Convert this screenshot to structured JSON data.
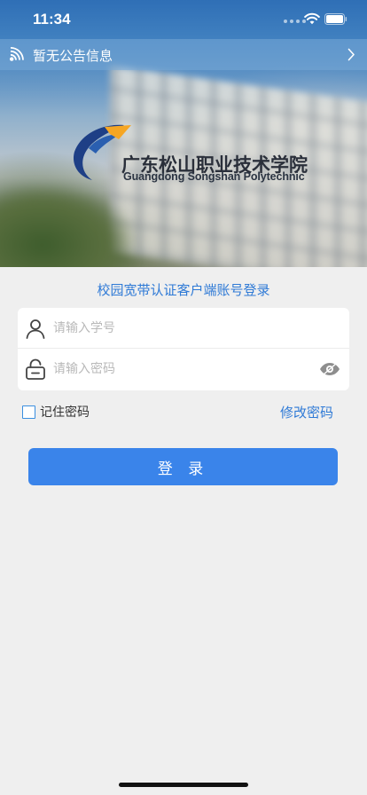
{
  "status_bar": {
    "time": "11:34"
  },
  "notice": {
    "text": "暂无公告信息",
    "icon": "broadcast-icon",
    "chevron_icon": "chevron-right-icon"
  },
  "logo": {
    "name_cn": "广东松山职业技术学院",
    "name_en": "Guangdong Songshan Polytechnic"
  },
  "login": {
    "title": "校园宽带认证客户端账号登录",
    "username_placeholder": "请输入学号",
    "password_placeholder": "请输入密码",
    "remember_label": "记住密码",
    "change_password_label": "修改密码",
    "login_button_label": "登 录"
  },
  "colors": {
    "accent": "#3a84ea",
    "link": "#2f7ad6",
    "background": "#efefef"
  }
}
